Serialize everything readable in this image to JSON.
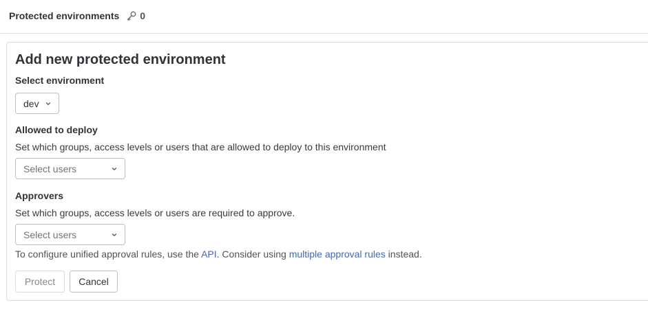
{
  "header": {
    "title": "Protected environments",
    "count": "0",
    "icon": "shield-key-icon"
  },
  "form": {
    "title": "Add new protected environment",
    "environment": {
      "label": "Select environment",
      "selected": "dev"
    },
    "deploy": {
      "label": "Allowed to deploy",
      "help": "Set which groups, access levels or users that are allowed to deploy to this environment",
      "placeholder": "Select users"
    },
    "approvers": {
      "label": "Approvers",
      "help": "Set which groups, access levels or users are required to approve.",
      "placeholder": "Select users"
    },
    "info": {
      "prefix": "To configure unified approval rules, use the ",
      "api_link": "API",
      "middle": ". Consider using ",
      "rules_link": "multiple approval rules",
      "suffix": " instead."
    },
    "buttons": {
      "protect": "Protect",
      "cancel": "Cancel"
    }
  },
  "colors": {
    "link": "#3d6ac0",
    "border": "#dcdcde"
  }
}
